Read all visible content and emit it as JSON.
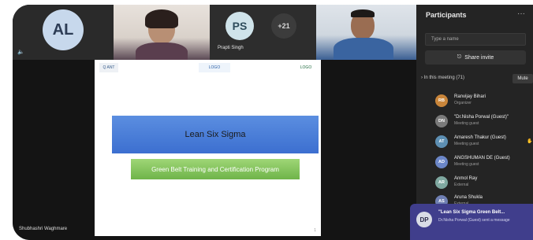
{
  "tiles": {
    "al_initials": "AL",
    "ps_initials": "PS",
    "ps_name": "Prapti Singh",
    "more_count": "+21"
  },
  "slide": {
    "logo_left": "Q ANT",
    "logo_mid": "LOGO",
    "logo_right": "LOGO",
    "title": "Lean Six Sigma",
    "subtitle": "Green Belt Training and Certification Program",
    "page": "1"
  },
  "presenter_name": "Shubhashri Waghmare",
  "panel": {
    "title": "Participants",
    "more": "···",
    "search_placeholder": "Type a name",
    "share_label": "Share invite",
    "meeting_label": "In this meeting (71)",
    "mute_label": "Mute",
    "participants": [
      {
        "initials": "RB",
        "name": "Ranvijay Bihari",
        "role": "Organizer",
        "color": "#c9853a"
      },
      {
        "initials": "DN",
        "name": "\"Dr.Nisha Porwal (Guest)\"",
        "role": "Meeting guest",
        "color": "#7a7a7a"
      },
      {
        "initials": "AT",
        "name": "Amaresh Thakur (Guest)",
        "role": "Meeting guest",
        "color": "#5d8fb3"
      },
      {
        "initials": "AD",
        "name": "ANGSHUMAN DE (Guest)",
        "role": "Meeting guest",
        "color": "#6b86c7"
      },
      {
        "initials": "AR",
        "name": "Anmol Ray",
        "role": "External",
        "color": "#7fa8a0"
      },
      {
        "initials": "AS",
        "name": "Aruna Shukla",
        "role": "External",
        "color": "#6f7fb3"
      }
    ]
  },
  "toast": {
    "initials": "DP",
    "title": "\"Lean Six Sigma Green Belt...",
    "body": "Dr.Nisha Porwal (Guest) sent a message"
  }
}
